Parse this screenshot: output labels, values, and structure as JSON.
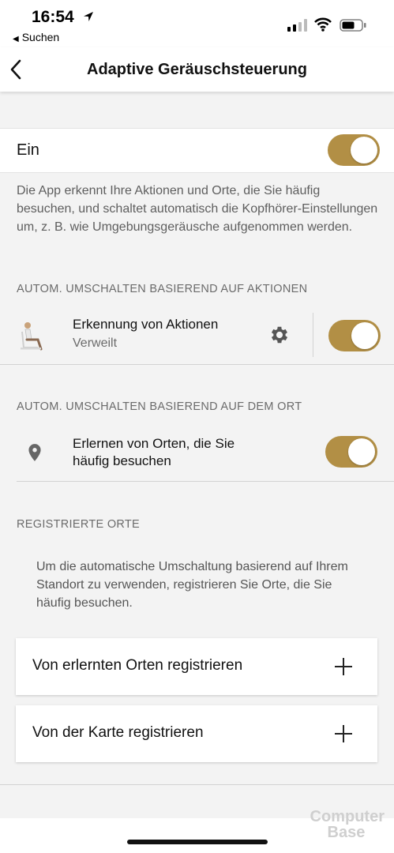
{
  "status_bar": {
    "time": "16:54",
    "back_app": "Suchen"
  },
  "nav": {
    "title": "Adaptive Geräuschsteuerung"
  },
  "main_toggle": {
    "label": "Ein",
    "on": true
  },
  "intro_text": "Die App erkennt Ihre Aktionen und Orte, die Sie häufig besuchen, und schaltet automatisch die Kopfhörer-Einstellungen um, z. B. wie Umgebungsgeräusche aufgenommen werden.",
  "section_actions": {
    "header": "AUTOM. UMSCHALTEN BASIEREND AUF AKTIONEN",
    "row": {
      "title": "Erkennung von Aktionen",
      "subtitle": "Verweilt",
      "on": true
    }
  },
  "section_location": {
    "header": "AUTOM. UMSCHALTEN BASIEREND AUF DEM ORT",
    "row": {
      "title_line1": "Erlernen von Orten, die Sie",
      "title_line2": "häufig besuchen",
      "on": true
    }
  },
  "section_registered": {
    "header": "REGISTRIERTE ORTE",
    "info": "Um die automatische Umschaltung basierend auf Ihrem Standort zu verwenden, registrieren Sie Orte, die Sie häufig besuchen.",
    "cards": [
      {
        "label": "Von erlernten Orten registrieren"
      },
      {
        "label": "Von der Karte registrieren"
      }
    ]
  },
  "watermark": {
    "line1": "Computer",
    "line2": "Base"
  },
  "colors": {
    "accent": "#b28f45",
    "background": "#f3f3f3"
  }
}
